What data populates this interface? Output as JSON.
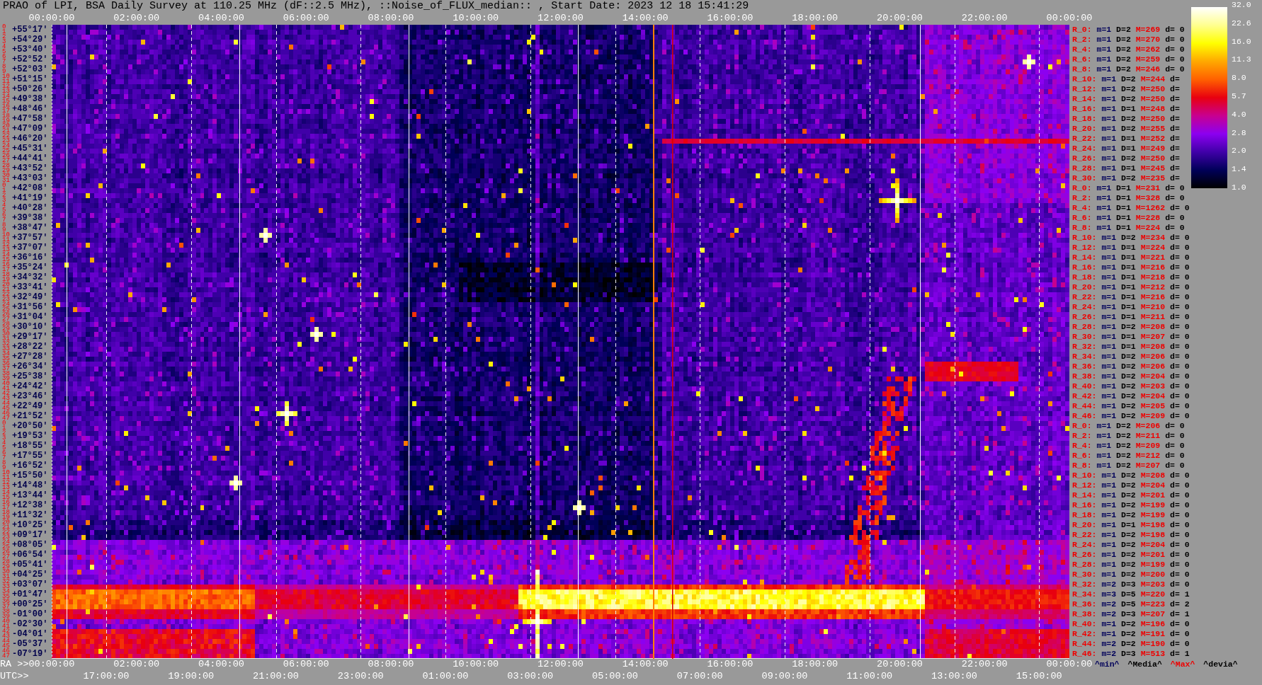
{
  "title": "PRAO of LPI, BSA Daily Survey at 110.25 MHz (dF::2.5 MHz), ::Noise_of_FLUX_median:: , Start Date: 2023 12 18 15:41:29",
  "top_axis": {
    "labels": [
      "00:00:00",
      "02:00:00",
      "04:00:00",
      "06:00:00",
      "08:00:00",
      "10:00:00",
      "12:00:00",
      "14:00:00",
      "16:00:00",
      "18:00:00",
      "20:00:00",
      "22:00:00",
      "00:00:00"
    ]
  },
  "rows": [
    {
      "indices": [
        "0",
        "1"
      ],
      "declination": "+55°17'",
      "stats": {
        "label": "R_0:",
        "min": "m=1",
        "median": "D=2",
        "max": "M=269",
        "deviation": "d= 0"
      }
    },
    {
      "indices": [
        "2",
        "3"
      ],
      "declination": "+54°29'",
      "stats": {
        "label": "R_2:",
        "min": "m=1",
        "median": "D=2",
        "max": "M=270",
        "deviation": "d= 0"
      }
    },
    {
      "indices": [
        "4",
        "5"
      ],
      "declination": "+53°40'",
      "stats": {
        "label": "R_4:",
        "min": "m=1",
        "median": "D=2",
        "max": "M=262",
        "deviation": "d= 0"
      }
    },
    {
      "indices": [
        "6",
        "7"
      ],
      "declination": "+52°52'",
      "stats": {
        "label": "R_6:",
        "min": "m=1",
        "median": "D=2",
        "max": "M=259",
        "deviation": "d= 0"
      }
    },
    {
      "indices": [
        "8",
        "9"
      ],
      "declination": "+52°03'",
      "stats": {
        "label": "R_8:",
        "min": "m=1",
        "median": "D=2",
        "max": "M=246",
        "deviation": "d= 0"
      }
    },
    {
      "indices": [
        "10",
        "11"
      ],
      "declination": "+51°15'",
      "stats": {
        "label": "R_10:",
        "min": "m=1",
        "median": "D=2",
        "max": "M=244",
        "deviation": "d="
      }
    },
    {
      "indices": [
        "12",
        "13"
      ],
      "declination": "+50°26'",
      "stats": {
        "label": "R_12:",
        "min": "m=1",
        "median": "D=2",
        "max": "M=250",
        "deviation": "d="
      }
    },
    {
      "indices": [
        "14",
        "15"
      ],
      "declination": "+49°38'",
      "stats": {
        "label": "R_14:",
        "min": "m=1",
        "median": "D=2",
        "max": "M=250",
        "deviation": "d="
      }
    },
    {
      "indices": [
        "16",
        "17"
      ],
      "declination": "+48°46'",
      "stats": {
        "label": "R_16:",
        "min": "m=1",
        "median": "D=1",
        "max": "M=248",
        "deviation": "d="
      }
    },
    {
      "indices": [
        "18",
        "19"
      ],
      "declination": "+47°58'",
      "stats": {
        "label": "R_18:",
        "min": "m=1",
        "median": "D=2",
        "max": "M=250",
        "deviation": "d="
      }
    },
    {
      "indices": [
        "20",
        "21"
      ],
      "declination": "+47°09'",
      "stats": {
        "label": "R_20:",
        "min": "m=1",
        "median": "D=2",
        "max": "M=255",
        "deviation": "d="
      }
    },
    {
      "indices": [
        "22",
        "23"
      ],
      "declination": "+46°20'",
      "stats": {
        "label": "R_22:",
        "min": "m=1",
        "median": "D=1",
        "max": "M=252",
        "deviation": "d="
      }
    },
    {
      "indices": [
        "24",
        "25"
      ],
      "declination": "+45°31'",
      "stats": {
        "label": "R_24:",
        "min": "m=1",
        "median": "D=1",
        "max": "M=249",
        "deviation": "d="
      }
    },
    {
      "indices": [
        "26",
        "27"
      ],
      "declination": "+44°41'",
      "stats": {
        "label": "R_26:",
        "min": "m=1",
        "median": "D=2",
        "max": "M=250",
        "deviation": "d="
      }
    },
    {
      "indices": [
        "28",
        "29"
      ],
      "declination": "+43°52'",
      "stats": {
        "label": "R_28:",
        "min": "m=1",
        "median": "D=1",
        "max": "M=245",
        "deviation": "d="
      }
    },
    {
      "indices": [
        "30",
        "31"
      ],
      "declination": "+43°03'",
      "stats": {
        "label": "R_30:",
        "min": "m=1",
        "median": "D=2",
        "max": "M=235",
        "deviation": "d="
      }
    },
    {
      "indices": [
        "0",
        "1"
      ],
      "declination": "+42°08'",
      "stats": {
        "label": "R_0:",
        "min": "m=1",
        "median": "D=1",
        "max": "M=231",
        "deviation": "d= 0"
      }
    },
    {
      "indices": [
        "2",
        "3"
      ],
      "declination": "+41°19'",
      "stats": {
        "label": "R_2:",
        "min": "m=1",
        "median": "D=1",
        "max": "M=328",
        "deviation": "d= 0"
      }
    },
    {
      "indices": [
        "4",
        "5"
      ],
      "declination": "+40°28'",
      "stats": {
        "label": "R_4:",
        "min": "m=1",
        "median": "D=1",
        "max": "M=1262",
        "deviation": "d= 0"
      }
    },
    {
      "indices": [
        "6",
        "7"
      ],
      "declination": "+39°38'",
      "stats": {
        "label": "R_6:",
        "min": "m=1",
        "median": "D=1",
        "max": "M=228",
        "deviation": "d= 0"
      }
    },
    {
      "indices": [
        "8",
        "9"
      ],
      "declination": "+38°47'",
      "stats": {
        "label": "R_8:",
        "min": "m=1",
        "median": "D=1",
        "max": "M=224",
        "deviation": "d= 0"
      }
    },
    {
      "indices": [
        "10",
        "11"
      ],
      "declination": "+37°57'",
      "stats": {
        "label": "R_10:",
        "min": "m=1",
        "median": "D=2",
        "max": "M=234",
        "deviation": "d= 0"
      }
    },
    {
      "indices": [
        "12",
        "13"
      ],
      "declination": "+37°07'",
      "stats": {
        "label": "R_12:",
        "min": "m=1",
        "median": "D=1",
        "max": "M=224",
        "deviation": "d= 0"
      }
    },
    {
      "indices": [
        "14",
        "15"
      ],
      "declination": "+36°16'",
      "stats": {
        "label": "R_14:",
        "min": "m=1",
        "median": "D=1",
        "max": "M=221",
        "deviation": "d= 0"
      }
    },
    {
      "indices": [
        "16",
        "17"
      ],
      "declination": "+35°24'",
      "stats": {
        "label": "R_16:",
        "min": "m=1",
        "median": "D=1",
        "max": "M=216",
        "deviation": "d= 0"
      }
    },
    {
      "indices": [
        "18",
        "19"
      ],
      "declination": "+34°32'",
      "stats": {
        "label": "R_18:",
        "min": "m=1",
        "median": "D=1",
        "max": "M=218",
        "deviation": "d= 0"
      }
    },
    {
      "indices": [
        "20",
        "21"
      ],
      "declination": "+33°41'",
      "stats": {
        "label": "R_20:",
        "min": "m=1",
        "median": "D=1",
        "max": "M=212",
        "deviation": "d= 0"
      }
    },
    {
      "indices": [
        "22",
        "23"
      ],
      "declination": "+32°49'",
      "stats": {
        "label": "R_22:",
        "min": "m=1",
        "median": "D=1",
        "max": "M=216",
        "deviation": "d= 0"
      }
    },
    {
      "indices": [
        "24",
        "25"
      ],
      "declination": "+31°56'",
      "stats": {
        "label": "R_24:",
        "min": "m=1",
        "median": "D=1",
        "max": "M=210",
        "deviation": "d= 0"
      }
    },
    {
      "indices": [
        "26",
        "27"
      ],
      "declination": "+31°04'",
      "stats": {
        "label": "R_26:",
        "min": "m=1",
        "median": "D=1",
        "max": "M=211",
        "deviation": "d= 0"
      }
    },
    {
      "indices": [
        "28",
        "29"
      ],
      "declination": "+30°10'",
      "stats": {
        "label": "R_28:",
        "min": "m=1",
        "median": "D=2",
        "max": "M=208",
        "deviation": "d= 0"
      }
    },
    {
      "indices": [
        "30",
        "31"
      ],
      "declination": "+29°17'",
      "stats": {
        "label": "R_30:",
        "min": "m=1",
        "median": "D=1",
        "max": "M=207",
        "deviation": "d= 0"
      }
    },
    {
      "indices": [
        "32",
        "33"
      ],
      "declination": "+28°22'",
      "stats": {
        "label": "R_32:",
        "min": "m=1",
        "median": "D=1",
        "max": "M=208",
        "deviation": "d= 0"
      }
    },
    {
      "indices": [
        "34",
        "35"
      ],
      "declination": "+27°28'",
      "stats": {
        "label": "R_34:",
        "min": "m=1",
        "median": "D=2",
        "max": "M=206",
        "deviation": "d= 0"
      }
    },
    {
      "indices": [
        "36",
        "37"
      ],
      "declination": "+26°34'",
      "stats": {
        "label": "R_36:",
        "min": "m=1",
        "median": "D=2",
        "max": "M=206",
        "deviation": "d= 0"
      }
    },
    {
      "indices": [
        "38",
        "39"
      ],
      "declination": "+25°38'",
      "stats": {
        "label": "R_38:",
        "min": "m=1",
        "median": "D=2",
        "max": "M=204",
        "deviation": "d= 0"
      }
    },
    {
      "indices": [
        "40",
        "41"
      ],
      "declination": "+24°42'",
      "stats": {
        "label": "R_40:",
        "min": "m=1",
        "median": "D=2",
        "max": "M=203",
        "deviation": "d= 0"
      }
    },
    {
      "indices": [
        "42",
        "43"
      ],
      "declination": "+23°46'",
      "stats": {
        "label": "R_42:",
        "min": "m=1",
        "median": "D=2",
        "max": "M=204",
        "deviation": "d= 0"
      }
    },
    {
      "indices": [
        "44",
        "45"
      ],
      "declination": "+22°49'",
      "stats": {
        "label": "R_44:",
        "min": "m=1",
        "median": "D=2",
        "max": "M=205",
        "deviation": "d= 0"
      }
    },
    {
      "indices": [
        "46",
        "47"
      ],
      "declination": "+21°52'",
      "stats": {
        "label": "R_46:",
        "min": "m=1",
        "median": "D=2",
        "max": "M=209",
        "deviation": "d= 0"
      }
    },
    {
      "indices": [
        "0",
        "1"
      ],
      "declination": "+20°50'",
      "stats": {
        "label": "R_0:",
        "min": "m=1",
        "median": "D=2",
        "max": "M=206",
        "deviation": "d= 0"
      }
    },
    {
      "indices": [
        "2",
        "3"
      ],
      "declination": "+19°53'",
      "stats": {
        "label": "R_2:",
        "min": "m=1",
        "median": "D=2",
        "max": "M=211",
        "deviation": "d= 0"
      }
    },
    {
      "indices": [
        "4",
        "5"
      ],
      "declination": "+18°55'",
      "stats": {
        "label": "R_4:",
        "min": "m=1",
        "median": "D=2",
        "max": "M=209",
        "deviation": "d= 0"
      }
    },
    {
      "indices": [
        "6",
        "7"
      ],
      "declination": "+17°55'",
      "stats": {
        "label": "R_6:",
        "min": "m=1",
        "median": "D=2",
        "max": "M=212",
        "deviation": "d= 0"
      }
    },
    {
      "indices": [
        "8",
        "9"
      ],
      "declination": "+16°52'",
      "stats": {
        "label": "R_8:",
        "min": "m=1",
        "median": "D=2",
        "max": "M=207",
        "deviation": "d= 0"
      }
    },
    {
      "indices": [
        "10",
        "11"
      ],
      "declination": "+15°50'",
      "stats": {
        "label": "R_10:",
        "min": "m=1",
        "median": "D=2",
        "max": "M=208",
        "deviation": "d= 0"
      }
    },
    {
      "indices": [
        "12",
        "13"
      ],
      "declination": "+14°48'",
      "stats": {
        "label": "R_12:",
        "min": "m=1",
        "median": "D=2",
        "max": "M=204",
        "deviation": "d= 0"
      }
    },
    {
      "indices": [
        "14",
        "15"
      ],
      "declination": "+13°44'",
      "stats": {
        "label": "R_14:",
        "min": "m=1",
        "median": "D=2",
        "max": "M=201",
        "deviation": "d= 0"
      }
    },
    {
      "indices": [
        "16",
        "17"
      ],
      "declination": "+12°38'",
      "stats": {
        "label": "R_16:",
        "min": "m=1",
        "median": "D=2",
        "max": "M=199",
        "deviation": "d= 0"
      }
    },
    {
      "indices": [
        "18",
        "19"
      ],
      "declination": "+11°32'",
      "stats": {
        "label": "R_18:",
        "min": "m=1",
        "median": "D=2",
        "max": "M=199",
        "deviation": "d= 0"
      }
    },
    {
      "indices": [
        "20",
        "21"
      ],
      "declination": "+10°25'",
      "stats": {
        "label": "R_20:",
        "min": "m=1",
        "median": "D=1",
        "max": "M=198",
        "deviation": "d= 0"
      }
    },
    {
      "indices": [
        "22",
        "23"
      ],
      "declination": "+09°17'",
      "stats": {
        "label": "R_22:",
        "min": "m=1",
        "median": "D=2",
        "max": "M=198",
        "deviation": "d= 0"
      }
    },
    {
      "indices": [
        "24",
        "25"
      ],
      "declination": "+08°05'",
      "stats": {
        "label": "R_24:",
        "min": "m=1",
        "median": "D=2",
        "max": "M=204",
        "deviation": "d= 0"
      }
    },
    {
      "indices": [
        "26",
        "27"
      ],
      "declination": "+06°54'",
      "stats": {
        "label": "R_26:",
        "min": "m=1",
        "median": "D=2",
        "max": "M=201",
        "deviation": "d= 0"
      }
    },
    {
      "indices": [
        "28",
        "29"
      ],
      "declination": "+05°41'",
      "stats": {
        "label": "R_28:",
        "min": "m=1",
        "median": "D=2",
        "max": "M=199",
        "deviation": "d= 0"
      }
    },
    {
      "indices": [
        "30",
        "31"
      ],
      "declination": "+04°25'",
      "stats": {
        "label": "R_30:",
        "min": "m=1",
        "median": "D=2",
        "max": "M=200",
        "deviation": "d= 0"
      }
    },
    {
      "indices": [
        "32",
        "33"
      ],
      "declination": "+03°07'",
      "stats": {
        "label": "R_32:",
        "min": "m=2",
        "median": "D=3",
        "max": "M=203",
        "deviation": "d= 0"
      }
    },
    {
      "indices": [
        "34",
        "35"
      ],
      "declination": "+01°47'",
      "stats": {
        "label": "R_34:",
        "min": "m=3",
        "median": "D=5",
        "max": "M=220",
        "deviation": "d= 1"
      }
    },
    {
      "indices": [
        "36",
        "37"
      ],
      "declination": "+00°25'",
      "stats": {
        "label": "R_36:",
        "min": "m=2",
        "median": "D=5",
        "max": "M=223",
        "deviation": "d= 2"
      }
    },
    {
      "indices": [
        "38",
        "39"
      ],
      "declination": "-01°00'",
      "stats": {
        "label": "R_38:",
        "min": "m=2",
        "median": "D=3",
        "max": "M=207",
        "deviation": "d= 1"
      }
    },
    {
      "indices": [
        "40",
        "41"
      ],
      "declination": "-02°30'",
      "stats": {
        "label": "R_40:",
        "min": "m=1",
        "median": "D=2",
        "max": "M=196",
        "deviation": "d= 0"
      }
    },
    {
      "indices": [
        "42",
        "43"
      ],
      "declination": "-04°01'",
      "stats": {
        "label": "R_42:",
        "min": "m=1",
        "median": "D=2",
        "max": "M=191",
        "deviation": "d= 0"
      }
    },
    {
      "indices": [
        "44",
        "45"
      ],
      "declination": "-05°37'",
      "stats": {
        "label": "R_44:",
        "min": "m=2",
        "median": "D=2",
        "max": "M=190",
        "deviation": "d= 0"
      }
    },
    {
      "indices": [
        "46",
        "47"
      ],
      "declination": "-07°19'",
      "stats": {
        "label": "R_46:",
        "min": "m=2",
        "median": "D=3",
        "max": "M=513",
        "deviation": "d= 1"
      }
    }
  ],
  "colorbar": {
    "ticks": [
      "32.0",
      "22.6",
      "16.0",
      "11.3",
      "8.0",
      "5.7",
      "4.0",
      "2.8",
      "2.0",
      "1.4",
      "1.0"
    ]
  },
  "ra_axis": {
    "title": "RA >>",
    "labels": [
      "00:00:00",
      "02:00:00",
      "04:00:00",
      "06:00:00",
      "08:00:00",
      "10:00:00",
      "12:00:00",
      "14:00:00",
      "16:00:00",
      "18:00:00",
      "20:00:00",
      "22:00:00",
      "00:00:00"
    ]
  },
  "legend": [
    {
      "text": "^min^",
      "kind": "min"
    },
    {
      "text": "^Media^",
      "kind": "median"
    },
    {
      "text": "^Max^",
      "kind": "max"
    },
    {
      "text": "^devia^",
      "kind": "deviation"
    }
  ],
  "utc_axis": {
    "title": "UTC>>",
    "labels": [
      "17:00:00",
      "19:00:00",
      "21:00:00",
      "23:00:00",
      "01:00:00",
      "03:00:00",
      "05:00:00",
      "07:00:00",
      "09:00:00",
      "11:00:00",
      "13:00:00",
      "15:00:00"
    ]
  }
}
